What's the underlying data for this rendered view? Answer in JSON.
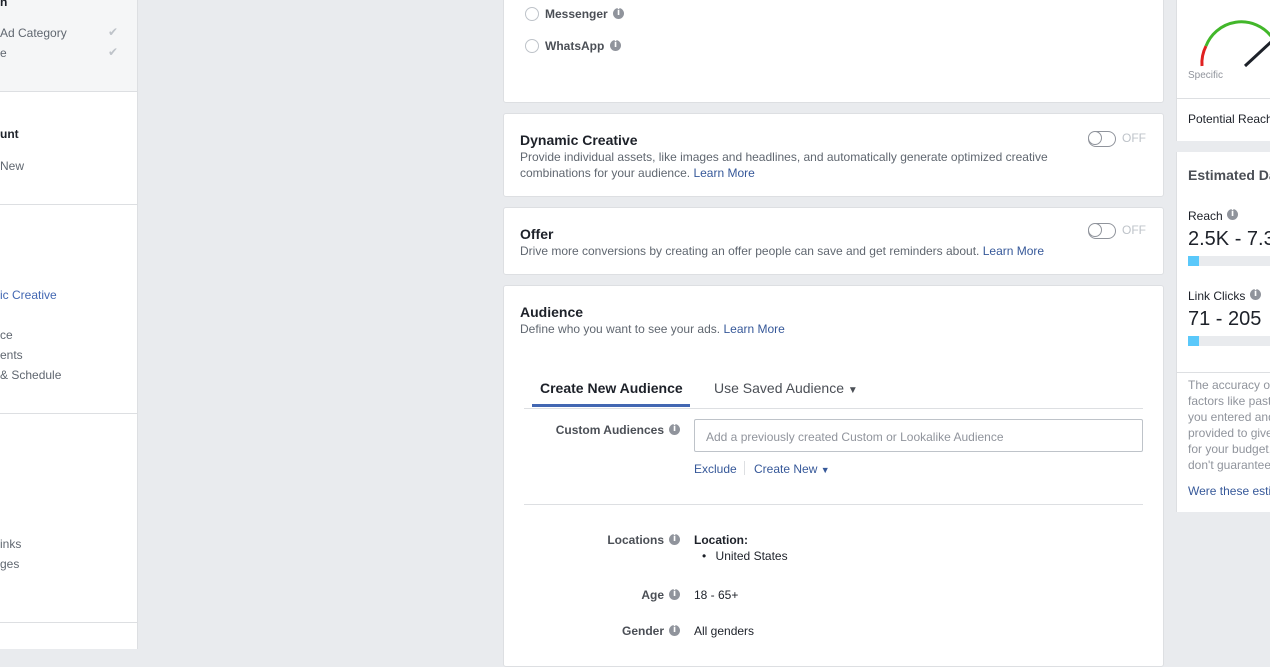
{
  "sidebar": {
    "top_items": [
      {
        "label": "n"
      },
      {
        "label": "Ad Category"
      },
      {
        "label": "e"
      }
    ],
    "account_heading": "unt",
    "account_sub": "New",
    "creative_active": "ic Creative",
    "ad_items": [
      "ce",
      "ents",
      "& Schedule"
    ],
    "bottom_items": [
      "inks",
      "ges"
    ]
  },
  "placements": {
    "messenger": "Messenger",
    "whatsapp": "WhatsApp"
  },
  "dynamic_creative": {
    "title": "Dynamic Creative",
    "desc": "Provide individual assets, like images and headlines, and automatically generate optimized creative combinations for your audience.",
    "learn_more": "Learn More",
    "toggle_state": "OFF"
  },
  "offer": {
    "title": "Offer",
    "desc": "Drive more conversions by creating an offer people can save and get reminders about.",
    "learn_more": "Learn More",
    "toggle_state": "OFF"
  },
  "audience": {
    "title": "Audience",
    "desc": "Define who you want to see your ads.",
    "learn_more": "Learn More",
    "tabs": {
      "create": "Create New Audience",
      "saved": "Use Saved Audience"
    },
    "custom_audiences_label": "Custom Audiences",
    "custom_audiences_placeholder": "Add a previously created Custom or Lookalike Audience",
    "exclude": "Exclude",
    "create_new": "Create New",
    "locations_label": "Locations",
    "location_heading": "Location:",
    "location_value": "United States",
    "age_label": "Age",
    "age_value": "18 - 65+",
    "gender_label": "Gender",
    "gender_value": "All genders"
  },
  "right_panel": {
    "gauge_label": "Specific",
    "potential_reach": "Potential Reach",
    "estimated_title": "Estimated Da",
    "reach_label": "Reach",
    "reach_value": "2.5K - 7.3",
    "reach_fill": 0.12,
    "clicks_label": "Link Clicks",
    "clicks_value": "71 - 205",
    "clicks_fill": 0.12,
    "disclaimer": [
      "The accuracy o",
      "factors like past",
      "you entered and",
      "provided to give",
      "for your budget,",
      "don't guarantee"
    ],
    "feedback_link": "Were these esti"
  },
  "colors": {
    "accent": "#4267b2",
    "link": "#365899",
    "bar": "#5ac8fa",
    "gauge_green": "#42b72a",
    "gauge_red": "#e02020"
  }
}
